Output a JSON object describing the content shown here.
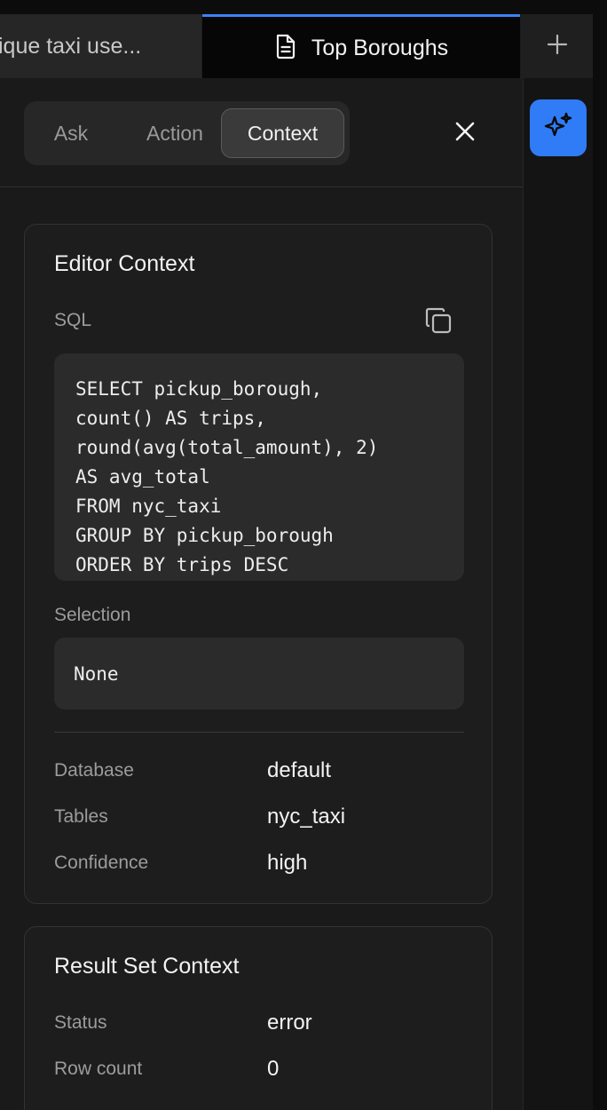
{
  "tabs": {
    "previous_label": "ique taxi use...",
    "active_label": "Top Boroughs",
    "active_icon": "document-icon",
    "add_icon": "plus-icon"
  },
  "side": {
    "ai_icon": "sparkles-icon",
    "accent": "#2f7cf6"
  },
  "mode_toggle": {
    "ask": "Ask",
    "action": "Action",
    "context": "Context",
    "selected": "Context"
  },
  "editor_context": {
    "title": "Editor Context",
    "sql_label": "SQL",
    "sql_lines": [
      "SELECT pickup_borough,",
      "count() AS trips,",
      "round(avg(total_amount), 2)",
      "AS avg_total",
      "FROM nyc_taxi",
      "GROUP BY pickup_borough",
      "ORDER BY trips DESC"
    ],
    "selection_label": "Selection",
    "selection_value": "None",
    "database_label": "Database",
    "database_value": "default",
    "tables_label": "Tables",
    "tables_value": "nyc_taxi",
    "confidence_label": "Confidence",
    "confidence_value": "high"
  },
  "result_context": {
    "title": "Result Set Context",
    "status_label": "Status",
    "status_value": "error",
    "rowcount_label": "Row count",
    "rowcount_value": "0"
  }
}
